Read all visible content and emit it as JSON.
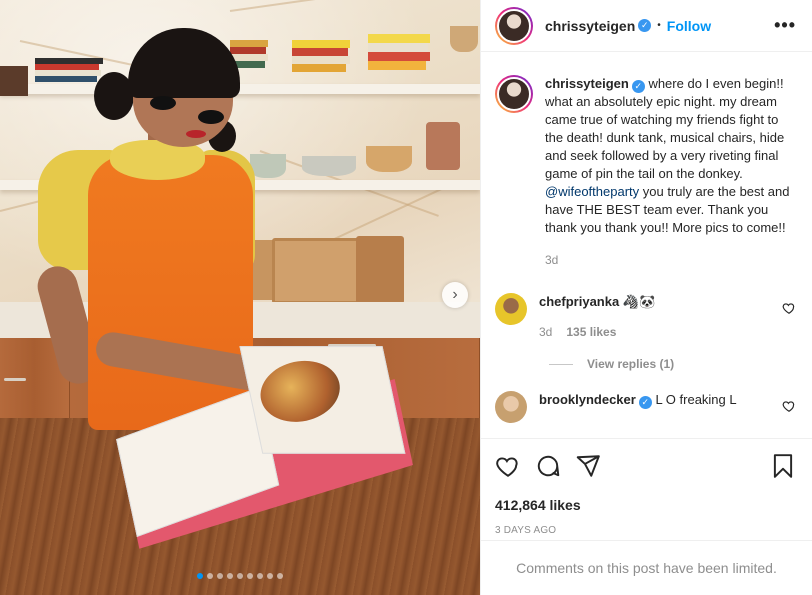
{
  "post": {
    "author": "chrissyteigen",
    "follow_label": "Follow",
    "more_label": "•••",
    "verified_glyph": "✓",
    "separator": "•"
  },
  "caption": {
    "username": "chrissyteigen",
    "text_before": " where do I even begin!! what an absolutely epic night. my dream came true of watching my friends fight to the death! dunk tank, musical chairs, hide and seek followed by a very riveting final game of pin the tail on the donkey. ",
    "mention": "@wifeoftheparty",
    "text_after": " you truly are the best and have THE BEST team ever. Thank you thank you thank you!! More pics to come!!",
    "time": "3d"
  },
  "comments": [
    {
      "username": "chefpriyanka",
      "text": " 🦓🐼",
      "time": "3d",
      "likes": "135 likes",
      "view_replies": "View replies (1)"
    },
    {
      "username": "brooklyndecker",
      "text": " L O freaking L"
    }
  ],
  "stats": {
    "likes": "412,864 likes",
    "posted": "3 DAYS AGO"
  },
  "footer": {
    "limited": "Comments on this post have been limited."
  },
  "carousel": {
    "count": 9,
    "active_index": 0,
    "next_glyph": "›"
  },
  "colors": {
    "accent": "#0095f6",
    "verified": "#3897f0",
    "dress": "#f07a20"
  },
  "icons": [
    "like-icon",
    "comment-icon",
    "share-icon",
    "save-icon",
    "heart-icon",
    "verified-icon"
  ]
}
